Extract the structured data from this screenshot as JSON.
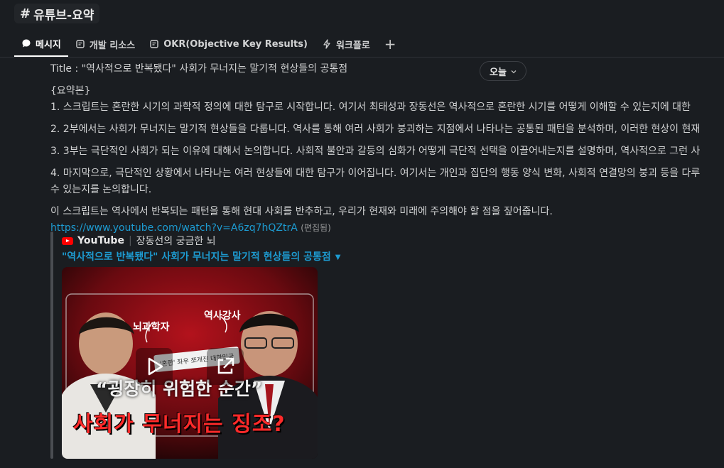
{
  "channel": {
    "hash": "#",
    "name": "유튜브-요약"
  },
  "tabs": [
    {
      "label": "메시지",
      "icon": "message-icon",
      "active": true
    },
    {
      "label": "개발 리소스",
      "icon": "canvas-icon"
    },
    {
      "label": "OKR(Objective Key Results)",
      "icon": "canvas-icon"
    },
    {
      "label": "워크플로",
      "icon": "workflow-icon"
    }
  ],
  "add_tab": "+",
  "date_pill": {
    "label": "오늘",
    "icon": "chevron-down-icon"
  },
  "message": {
    "title_line": "Title : \"역사적으로 반복됐다\" 사회가 무너지는 말기적 현상들의 공통점",
    "summary_header": "{요약본}",
    "point1": "1. 스크립트는 혼란한 시기의 과학적 정의에 대한 탐구로 시작합니다. 여기서 최태성과 장동선은 역사적으로 혼란한 시기를 어떻게 이해할 수 있는지에 대한",
    "point2": "2. 2부에서는 사회가 무너지는 말기적 현상들을 다룹니다. 역사를 통해 여러 사회가 붕괴하는 지점에서 나타나는 공통된 패턴을 분석하며, 이러한 현상이 현재",
    "point3": "3. 3부는 극단적인 사회가 되는 이유에 대해서 논의합니다. 사회적 불안과 갈등의 심화가 어떻게 극단적 선택을 이끌어내는지를 설명하며, 역사적으로 그런 사",
    "point4_a": "4. 마지막으로, 극단적인 상황에서 나타나는 여러 현상들에 대한 탐구가 이어집니다. 여기서는 개인과 집단의 행동 양식 변화, 사회적 연결망의 붕괴 등을 다루",
    "point4_b": "수 있는지를 논의합니다.",
    "closing": "이 스크립트는 역사에서 반복되는 패턴을 통해 현대 사회를 반추하고, 우리가 현재와 미래에 주의해야 할 점을 짚어줍니다.",
    "url": "https://www.youtube.com/watch?v=A6zq7hQZtrA",
    "edited": "(편집됨)"
  },
  "attachment": {
    "service": "YouTube",
    "separator": "|",
    "channel_name": "장동선의 궁금한 뇌",
    "video_title": "\"역사적으로 반복됐다\" 사회가 무너지는 말기적 현상들의 공통점",
    "thumbnail": {
      "label_left": "뇌과학자",
      "label_right": "역사강사",
      "sign_text": "'혼란' 좌우 쪼개진 대한민국",
      "quote": "“굉장히 위험한 순간”",
      "headline": "사회가 무너지는 징조?"
    }
  },
  "colors": {
    "background": "#1a1d21",
    "link": "#1d9bd1",
    "headline_red": "#ff2a2a"
  }
}
